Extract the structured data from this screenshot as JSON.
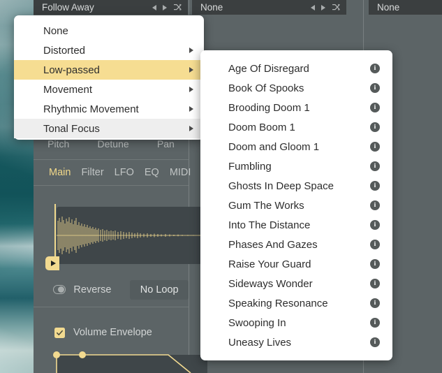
{
  "header": {
    "slots": [
      {
        "name": "Follow Away",
        "prev_icon": "triangle-left-icon",
        "next_icon": "triangle-right-icon",
        "shuffle_icon": "shuffle-icon"
      },
      {
        "name": "None",
        "prev_icon": "triangle-left-icon",
        "next_icon": "triangle-right-icon",
        "shuffle_icon": "shuffle-icon"
      },
      {
        "name": "None",
        "prev_icon": "triangle-left-icon",
        "next_icon": "triangle-right-icon",
        "shuffle_icon": "shuffle-icon"
      }
    ]
  },
  "knobs": [
    {
      "label": "Pitch"
    },
    {
      "label": "Detune"
    },
    {
      "label": "Pan"
    }
  ],
  "tabs": [
    {
      "label": "Main",
      "active": true
    },
    {
      "label": "Filter",
      "active": false
    },
    {
      "label": "LFO",
      "active": false
    },
    {
      "label": "EQ",
      "active": false
    },
    {
      "label": "MIDI",
      "active": false
    }
  ],
  "sample": {
    "play_marker_icon": "play-triangle-icon",
    "reverse_label": "Reverse",
    "reverse_toggle_icon": "toggle-off-icon",
    "loop_mode": "No Loop"
  },
  "envelope": {
    "checkbox_icon": "checkmark-icon",
    "label": "Volume Envelope"
  },
  "menu": {
    "items": [
      {
        "label": "None",
        "has_arrow": false,
        "state": "normal"
      },
      {
        "label": "Distorted",
        "has_arrow": true,
        "state": "normal"
      },
      {
        "label": "Low-passed",
        "has_arrow": true,
        "state": "selected"
      },
      {
        "label": "Movement",
        "has_arrow": true,
        "state": "normal"
      },
      {
        "label": "Rhythmic Movement",
        "has_arrow": true,
        "state": "normal"
      },
      {
        "label": "Tonal Focus",
        "has_arrow": true,
        "state": "hover"
      }
    ],
    "arrow_icon": "chevron-right-icon"
  },
  "submenu": {
    "info_icon": "info-icon",
    "items": [
      {
        "label": "Age Of Disregard"
      },
      {
        "label": "Book Of Spooks"
      },
      {
        "label": "Brooding Doom 1"
      },
      {
        "label": "Doom Boom 1"
      },
      {
        "label": "Doom and Gloom 1"
      },
      {
        "label": "Fumbling"
      },
      {
        "label": "Ghosts In Deep Space"
      },
      {
        "label": "Gum The Works"
      },
      {
        "label": "Into The Distance"
      },
      {
        "label": "Phases And Gazes"
      },
      {
        "label": "Raise Your Guard"
      },
      {
        "label": "Sideways Wonder"
      },
      {
        "label": "Speaking Resonance"
      },
      {
        "label": "Swooping In"
      },
      {
        "label": "Uneasy Lives"
      }
    ]
  },
  "colors": {
    "accent_yellow": "#f2da90",
    "menu_highlight": "#f6dd92",
    "menu_hover": "#eeeeee",
    "panel_bg": "#5c6466",
    "header_bg": "#3b3f40",
    "wave_bg": "#3f4649"
  }
}
